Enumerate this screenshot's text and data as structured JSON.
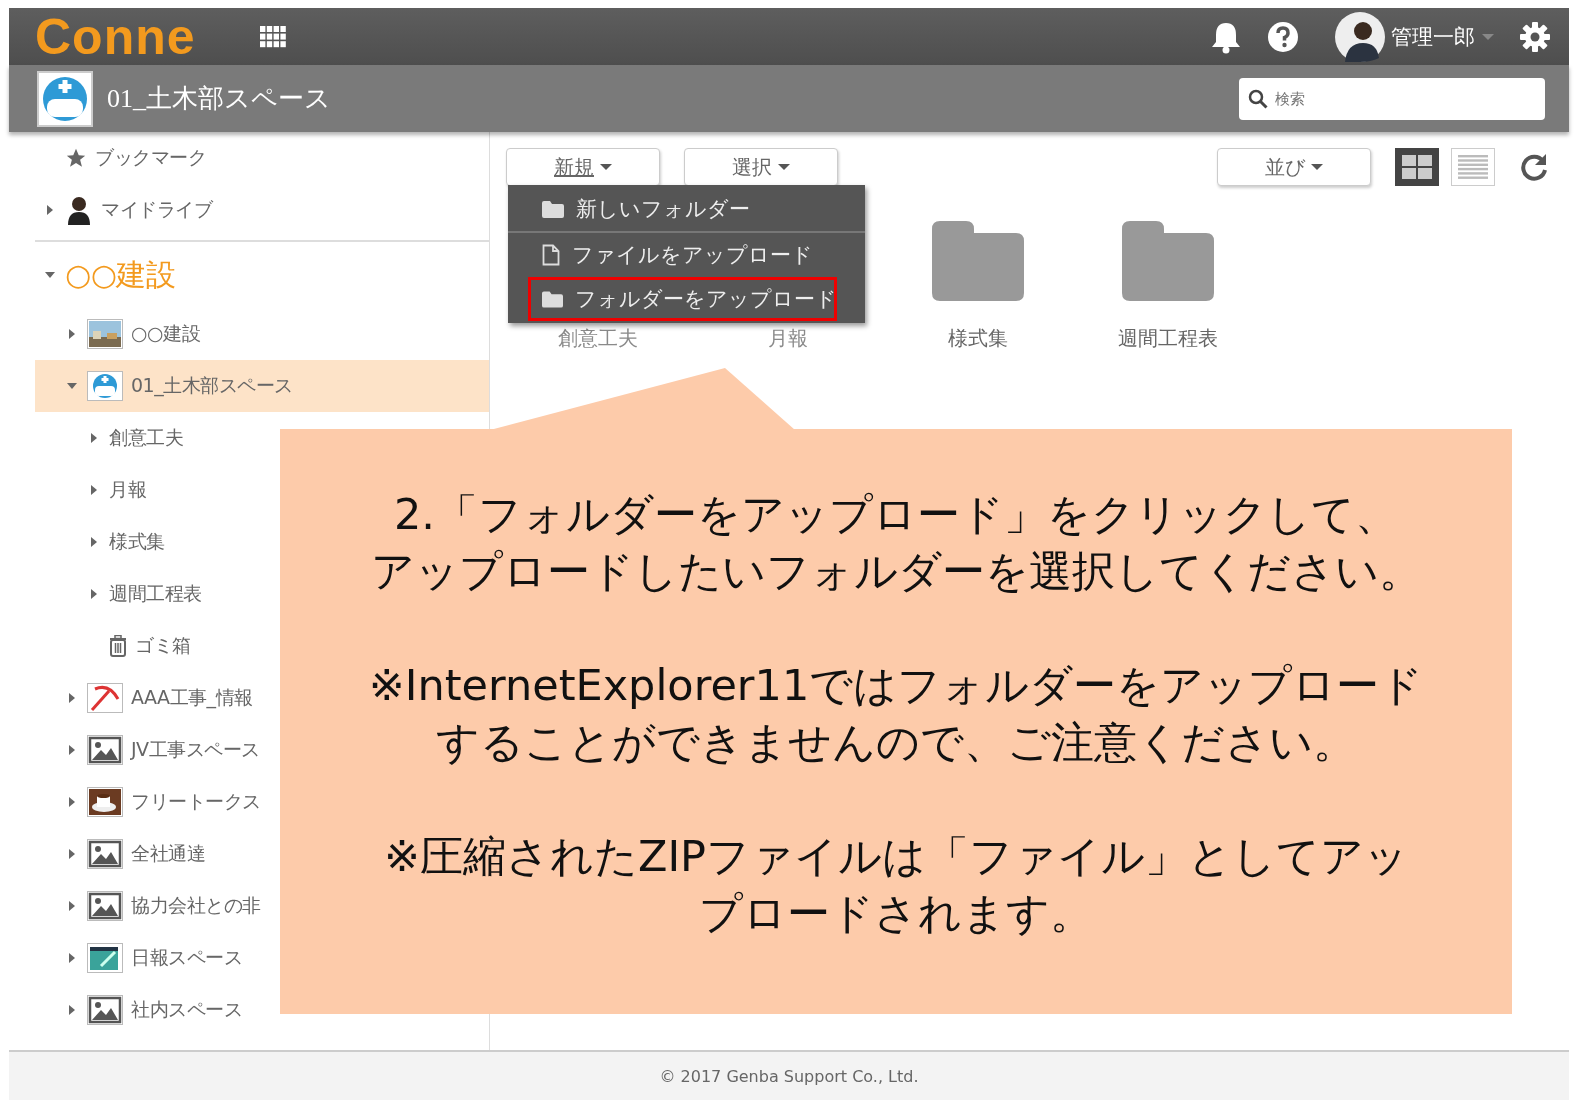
{
  "header": {
    "logo": "Conne",
    "user_name": "管理一郎"
  },
  "space_bar": {
    "title": "01_土木部スペース",
    "search": {
      "placeholder": "検索"
    }
  },
  "sidebar": {
    "items": [
      {
        "kind": "bookmark",
        "label": "ブックマーク",
        "selected": false
      },
      {
        "kind": "drive",
        "label": "マイドライブ",
        "expanded": false,
        "selected": false
      },
      {
        "kind": "group",
        "label": "○○建設",
        "expanded": true,
        "selected": false,
        "children": [
          {
            "kind": "space",
            "label": "○○建設",
            "expanded": false,
            "selected": false
          },
          {
            "kind": "space",
            "label": "01_土木部スペース",
            "expanded": true,
            "selected": true,
            "children": [
              {
                "kind": "folder",
                "label": "創意工夫",
                "expanded": false,
                "selected": false
              },
              {
                "kind": "folder",
                "label": "月報",
                "expanded": false,
                "selected": false
              },
              {
                "kind": "folder",
                "label": "様式集",
                "expanded": false,
                "selected": false
              },
              {
                "kind": "folder",
                "label": "週間工程表",
                "expanded": false,
                "selected": false
              },
              {
                "kind": "trash",
                "label": "ゴミ箱",
                "selected": false
              }
            ]
          },
          {
            "kind": "space",
            "label": "AAA工事_情報",
            "expanded": false,
            "selected": false
          },
          {
            "kind": "space",
            "label": "JV工事スペース",
            "expanded": false,
            "selected": false
          },
          {
            "kind": "space",
            "label": "フリートークス",
            "expanded": false,
            "selected": false
          },
          {
            "kind": "space",
            "label": "全社通達",
            "expanded": false,
            "selected": false
          },
          {
            "kind": "space",
            "label": "協力会社との非",
            "expanded": false,
            "selected": false
          },
          {
            "kind": "space",
            "label": "日報スペース",
            "expanded": false,
            "selected": false
          },
          {
            "kind": "space",
            "label": "社内スペース",
            "expanded": false,
            "selected": false
          }
        ]
      }
    ]
  },
  "toolbar": {
    "new_button": "新規",
    "select_button": "選択",
    "sort_button": "並び",
    "view_modes": [
      {
        "kind": "grid",
        "selected": true
      },
      {
        "kind": "list",
        "selected": false
      }
    ]
  },
  "menu": {
    "items": [
      {
        "kind": "folder",
        "label": "新しいフォルダー",
        "highlighted": false
      },
      {
        "kind": "file",
        "label": "ファイルをアップロード",
        "highlighted": false
      },
      {
        "kind": "folder",
        "label": "フォルダーをアップロード",
        "highlighted": true
      }
    ]
  },
  "folders": [
    {
      "label": "創意工夫",
      "covered": true
    },
    {
      "label": "月報",
      "covered": true
    },
    {
      "label": "様式集",
      "covered": false
    },
    {
      "label": "週間工程表",
      "covered": false
    }
  ],
  "callout": {
    "paragraphs": [
      {
        "lines": [
          "2.「フォルダーをアップロード」をクリックして、",
          "アップロードしたいフォルダーを選択してください。"
        ]
      },
      {
        "lines": [
          "※InternetExplorer11ではフォルダーをアップロード",
          "することができませんので、ご注意ください。"
        ]
      },
      {
        "lines": [
          "※圧縮されたZIPファイルは「ファイル」としてアッ",
          "プロードされます。"
        ]
      }
    ]
  },
  "footer": "© 2017 Genba Support Co., Ltd."
}
